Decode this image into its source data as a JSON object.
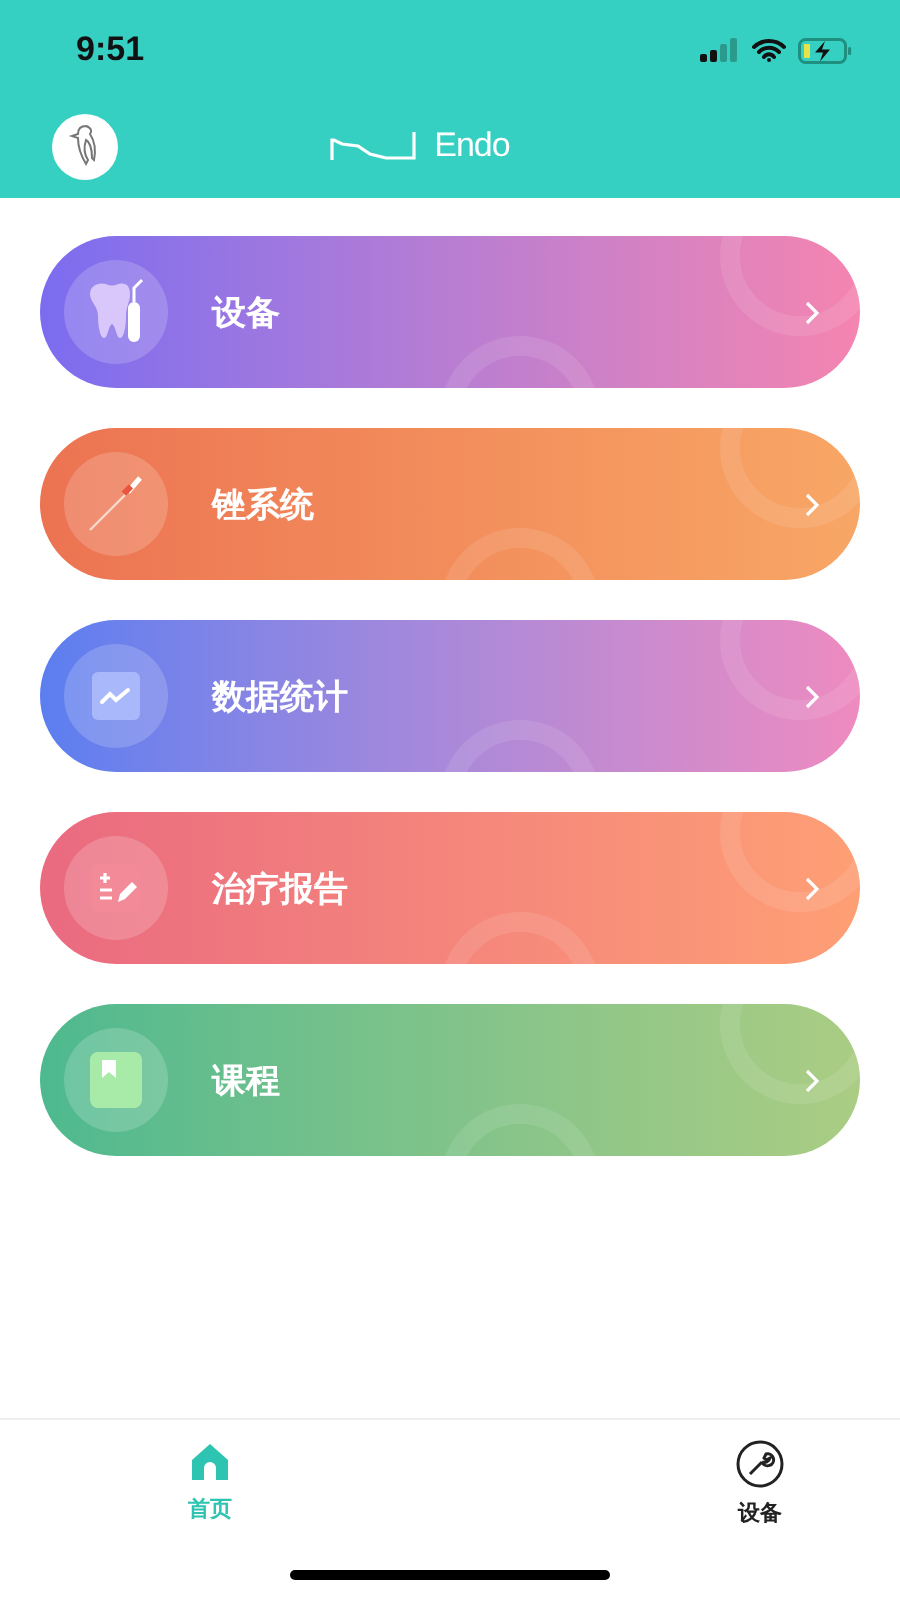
{
  "status_bar": {
    "time": "9:51"
  },
  "header": {
    "logo_text": "Endo"
  },
  "menu": [
    {
      "label": "设备",
      "kind": "tooth",
      "color": "#7b6cf0"
    },
    {
      "label": "锉系统",
      "kind": "file",
      "color": "#ec7352"
    },
    {
      "label": "数据统计",
      "kind": "chart",
      "color": "#5b7ef0"
    },
    {
      "label": "治疗报告",
      "kind": "report",
      "color": "#ea6a80"
    },
    {
      "label": "课程",
      "kind": "book",
      "color": "#4db98f"
    }
  ],
  "tab_bar": [
    {
      "label": "首页",
      "kind": "home",
      "selected": true
    },
    {
      "label": "设备",
      "kind": "tool",
      "selected": false
    }
  ]
}
